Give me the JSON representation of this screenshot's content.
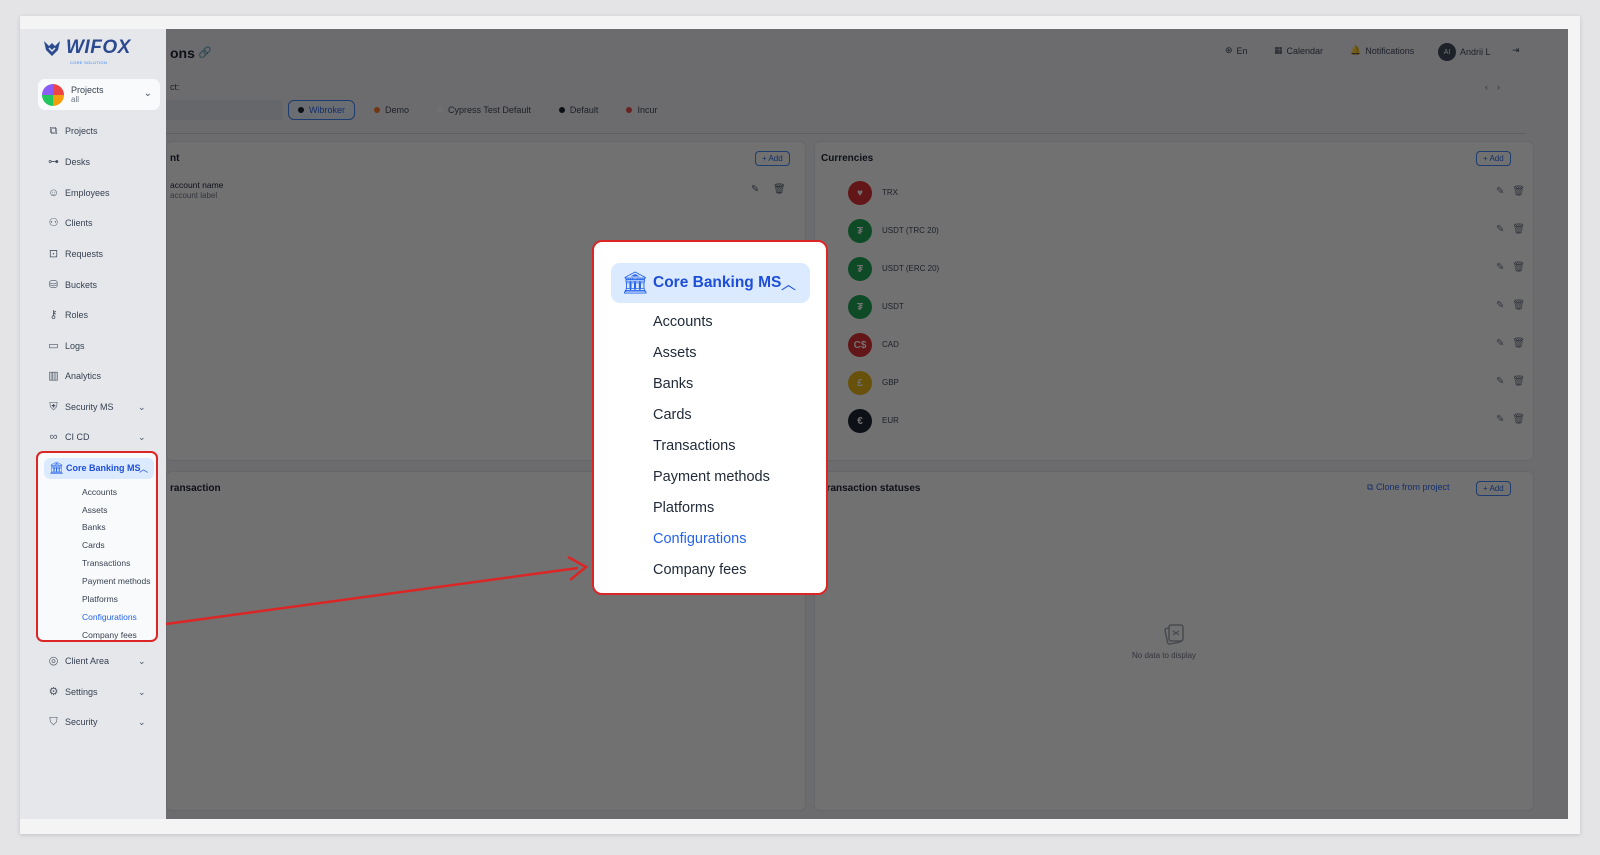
{
  "brand": {
    "name": "WIFOX",
    "tagline": "CORE SOLUTION"
  },
  "header": {
    "title": "ons",
    "language": "En",
    "calendar": "Calendar",
    "notifications": "Notifications",
    "avatar_initials": "AI",
    "user": "Andrii L"
  },
  "project_selector": {
    "title": "Projects",
    "subtitle": "all"
  },
  "sidebar": {
    "items": [
      {
        "label": "Projects"
      },
      {
        "label": "Desks"
      },
      {
        "label": "Employees"
      },
      {
        "label": "Clients"
      },
      {
        "label": "Requests"
      },
      {
        "label": "Buckets"
      },
      {
        "label": "Roles"
      },
      {
        "label": "Logs"
      },
      {
        "label": "Analytics"
      },
      {
        "label": "Security MS"
      },
      {
        "label": "CI CD"
      }
    ],
    "core_banking": {
      "label": "Core Banking MS",
      "subitems": [
        "Accounts",
        "Assets",
        "Banks",
        "Cards",
        "Transactions",
        "Payment methods",
        "Platforms",
        "Configurations",
        "Company fees"
      ],
      "active": "Configurations"
    },
    "bottom_items": [
      {
        "label": "Client Area"
      },
      {
        "label": "Settings"
      },
      {
        "label": "Security"
      }
    ]
  },
  "filter": {
    "label": "ct:",
    "chips": [
      "Wibroker",
      "Demo",
      "Cypress Test Default",
      "Default",
      "Incur"
    ],
    "chip_colors": [
      "#111827",
      "#f97316",
      "#ffffff",
      "#111827",
      "#ef4444"
    ]
  },
  "account_card": {
    "title": "nt",
    "add_label": "+ Add",
    "row_name": "account name",
    "row_label": "account label"
  },
  "currencies_card": {
    "title": "Currencies",
    "add_label": "+ Add",
    "rows": [
      {
        "name": "TRX",
        "symbol": "♥",
        "color": "#dc2626"
      },
      {
        "name": "USDT (TRC 20)",
        "symbol": "₮",
        "color": "#16a34a"
      },
      {
        "name": "USDT (ERC 20)",
        "symbol": "₮",
        "color": "#16a34a"
      },
      {
        "name": "USDT",
        "symbol": "₮",
        "color": "#16a34a"
      },
      {
        "name": "CAD",
        "symbol": "C$",
        "color": "#dc2626"
      },
      {
        "name": "GBP",
        "symbol": "£",
        "color": "#eab308"
      },
      {
        "name": "EUR",
        "symbol": "€",
        "color": "#111827"
      }
    ]
  },
  "transaction_card": {
    "title": "ransaction"
  },
  "statuses_card": {
    "title": "Transaction statuses",
    "clone_label": "Clone from project",
    "add_label": "+ Add",
    "empty_text": "No data to display"
  },
  "colors": {
    "accent": "#2563eb",
    "highlight_border": "#dc2626",
    "active_bg": "#dbeafe"
  }
}
